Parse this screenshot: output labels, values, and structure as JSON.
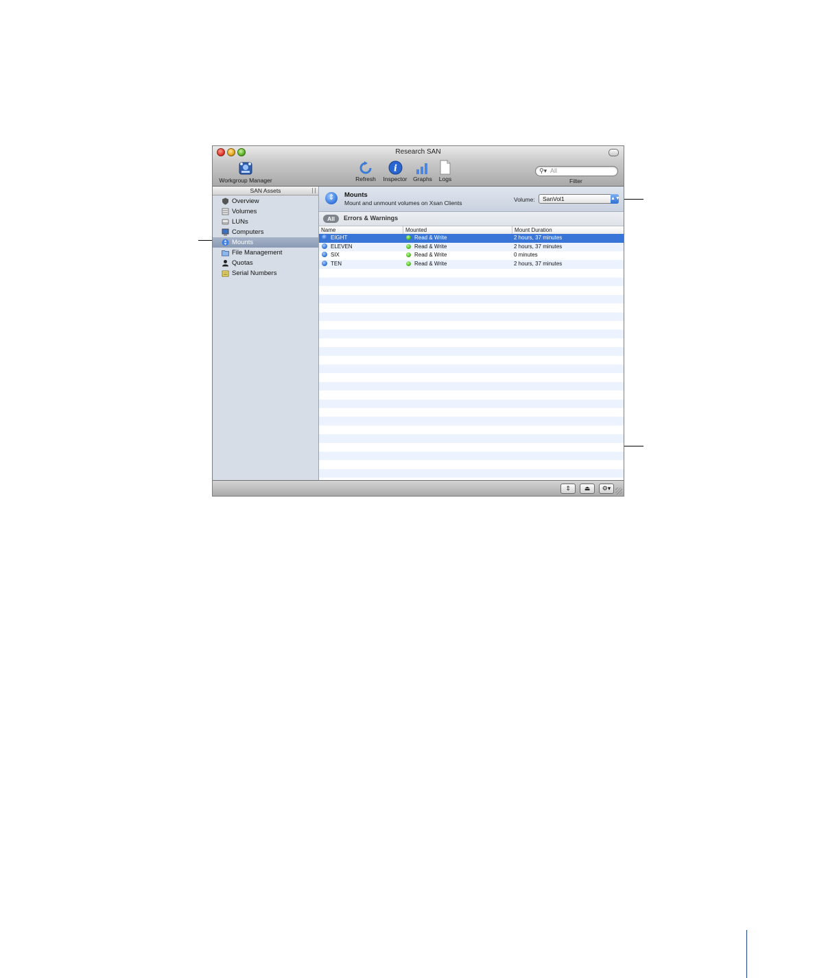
{
  "window": {
    "title": "Research SAN",
    "toolbar": {
      "workgroup_manager": "Workgroup Manager",
      "refresh": "Refresh",
      "inspector": "Inspector",
      "graphs": "Graphs",
      "logs": "Logs",
      "filter_placeholder": "All",
      "filter_label": "Filter"
    }
  },
  "sidebar": {
    "header": "SAN Assets",
    "items": [
      {
        "label": "Overview",
        "icon": "overview-icon"
      },
      {
        "label": "Volumes",
        "icon": "volumes-icon"
      },
      {
        "label": "LUNs",
        "icon": "luns-icon"
      },
      {
        "label": "Computers",
        "icon": "computers-icon"
      },
      {
        "label": "Mounts",
        "icon": "mounts-icon",
        "selected": true
      },
      {
        "label": "File Management",
        "icon": "file-management-icon"
      },
      {
        "label": "Quotas",
        "icon": "quotas-icon"
      },
      {
        "label": "Serial Numbers",
        "icon": "serial-numbers-icon"
      }
    ]
  },
  "panel": {
    "title": "Mounts",
    "description": "Mount and unmount volumes on Xsan Clients",
    "volume_label": "Volume:",
    "volume_value": "SanVol1"
  },
  "filter_bar": {
    "all_label": "All",
    "errors_label": "Errors & Warnings"
  },
  "table": {
    "columns": [
      "Name",
      "Mounted",
      "Mount Duration"
    ],
    "rows": [
      {
        "name": "EIGHT",
        "mounted": "Read & Write",
        "duration": "2 hours, 37 minutes",
        "selected": true
      },
      {
        "name": "ELEVEN",
        "mounted": "Read & Write",
        "duration": "2 hours, 37 minutes"
      },
      {
        "name": "SIX",
        "mounted": "Read & Write",
        "duration": "0 minutes"
      },
      {
        "name": "TEN",
        "mounted": "Read & Write",
        "duration": "2 hours, 37 minutes"
      }
    ]
  },
  "colors": {
    "selection": "#3875d7",
    "sidebar_bg": "#d6dde6",
    "row_alt": "#edf3fe"
  }
}
